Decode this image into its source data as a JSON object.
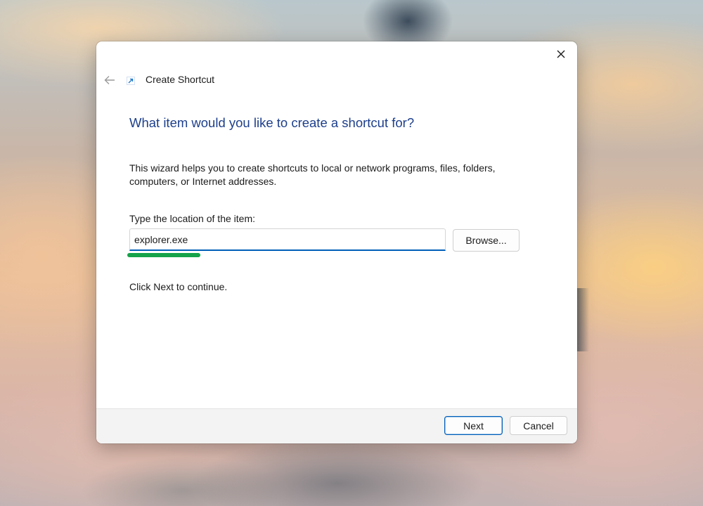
{
  "dialog": {
    "title": "Create Shortcut",
    "heading": "What item would you like to create a shortcut for?",
    "description": "This wizard helps you to create shortcuts to local or network programs, files, folders, computers, or Internet addresses.",
    "location_label": "Type the location of the item:",
    "location_value": "explorer.exe",
    "browse_label": "Browse...",
    "continue_text": "Click Next to continue.",
    "next_label": "Next",
    "cancel_label": "Cancel",
    "icons": {
      "close": "close-icon",
      "back": "back-arrow-icon",
      "shortcut": "shortcut-icon"
    }
  },
  "colors": {
    "heading": "#1d3f8c",
    "accent": "#005fb8",
    "marker": "#16a34a",
    "footer": "#f3f3f3"
  }
}
